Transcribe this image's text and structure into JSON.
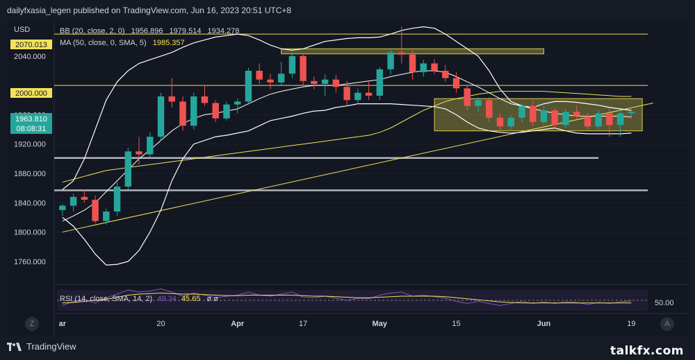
{
  "header": {
    "attribution": "dailyfxasia_legen published on TradingView.com, Jun 16, 2023 20:51 UTC+8"
  },
  "footer": {
    "brand": "TradingView",
    "watermark": "talkfx.com"
  },
  "chart_data": {
    "type": "candlestick",
    "currency": "USD",
    "indicators": {
      "bb": {
        "label": "BB (20, close, 2, 0)",
        "basis": "1956.896",
        "upper": "1979.514",
        "lower": "1934.278"
      },
      "ma": {
        "label": "MA (50, close, 0, SMA, 5)",
        "value": "1985.357"
      },
      "rsi": {
        "label": "RSI (14, close, SMA, 14, 2)",
        "value": "49.34",
        "ma_value": "45.65",
        "extra": "ø ø",
        "level": "50.00"
      }
    },
    "price_badges": {
      "last_price": "1963.810",
      "countdown": "08:08:31",
      "level_2070": "2070.013",
      "level_2000": "2000.000"
    },
    "y_axis": {
      "range": [
        1740,
        2090
      ],
      "ticks": [
        "2040.000",
        "1960.000",
        "1920.000",
        "1880.000",
        "1840.000",
        "1800.000",
        "1760.000"
      ],
      "tick_values": [
        2040,
        1960,
        1920,
        1880,
        1840,
        1800,
        1760
      ]
    },
    "x_axis": {
      "labels": [
        "ar",
        "20",
        "Apr",
        "17",
        "May",
        "15",
        "Jun",
        "19"
      ],
      "label_bar_index": [
        0,
        9,
        16,
        22,
        29,
        36,
        44,
        52
      ]
    },
    "horizontal_levels": [
      {
        "value": 2070.013,
        "color": "#f2e35a"
      },
      {
        "value": 2000.0,
        "color": "#f2e35a"
      },
      {
        "value": 1901,
        "color": "#b2b5be"
      },
      {
        "value": 1857,
        "color": "#b2b5be"
      }
    ],
    "zones": [
      {
        "from_bar": 20,
        "to_bar": 44,
        "low": 2043,
        "high": 2050
      },
      {
        "from_bar": 34,
        "to_bar": 53,
        "low": 1938,
        "high": 1982
      }
    ],
    "trendline": {
      "from": [
        0,
        1800
      ],
      "to": [
        54,
        1976
      ]
    },
    "candles": [
      {
        "o": 1830,
        "h": 1838,
        "l": 1822,
        "c": 1836
      },
      {
        "o": 1836,
        "h": 1852,
        "l": 1828,
        "c": 1848
      },
      {
        "o": 1848,
        "h": 1858,
        "l": 1840,
        "c": 1844
      },
      {
        "o": 1844,
        "h": 1850,
        "l": 1812,
        "c": 1815
      },
      {
        "o": 1815,
        "h": 1832,
        "l": 1810,
        "c": 1828
      },
      {
        "o": 1828,
        "h": 1868,
        "l": 1822,
        "c": 1862
      },
      {
        "o": 1862,
        "h": 1915,
        "l": 1858,
        "c": 1910
      },
      {
        "o": 1910,
        "h": 1930,
        "l": 1892,
        "c": 1906
      },
      {
        "o": 1906,
        "h": 1936,
        "l": 1902,
        "c": 1930
      },
      {
        "o": 1930,
        "h": 1990,
        "l": 1925,
        "c": 1985
      },
      {
        "o": 1985,
        "h": 2010,
        "l": 1970,
        "c": 1978
      },
      {
        "o": 1978,
        "h": 1985,
        "l": 1938,
        "c": 1945
      },
      {
        "o": 1945,
        "h": 1990,
        "l": 1940,
        "c": 1985
      },
      {
        "o": 1985,
        "h": 2000,
        "l": 1972,
        "c": 1976
      },
      {
        "o": 1976,
        "h": 1980,
        "l": 1950,
        "c": 1955
      },
      {
        "o": 1955,
        "h": 1978,
        "l": 1952,
        "c": 1974
      },
      {
        "o": 1974,
        "h": 1982,
        "l": 1962,
        "c": 1978
      },
      {
        "o": 1978,
        "h": 2024,
        "l": 1974,
        "c": 2020
      },
      {
        "o": 2020,
        "h": 2030,
        "l": 2002,
        "c": 2008
      },
      {
        "o": 2008,
        "h": 2016,
        "l": 1995,
        "c": 2004
      },
      {
        "o": 2004,
        "h": 2032,
        "l": 2000,
        "c": 2016
      },
      {
        "o": 2016,
        "h": 2045,
        "l": 2010,
        "c": 2040
      },
      {
        "o": 2040,
        "h": 2044,
        "l": 2000,
        "c": 2006
      },
      {
        "o": 2006,
        "h": 2012,
        "l": 1995,
        "c": 2002
      },
      {
        "o": 2002,
        "h": 2015,
        "l": 1985,
        "c": 2008
      },
      {
        "o": 2008,
        "h": 2014,
        "l": 1990,
        "c": 1998
      },
      {
        "o": 1998,
        "h": 2006,
        "l": 1972,
        "c": 1980
      },
      {
        "o": 1980,
        "h": 1996,
        "l": 1974,
        "c": 1990
      },
      {
        "o": 1990,
        "h": 2005,
        "l": 1980,
        "c": 1986
      },
      {
        "o": 1986,
        "h": 2025,
        "l": 1980,
        "c": 2022
      },
      {
        "o": 2022,
        "h": 2048,
        "l": 2015,
        "c": 2045
      },
      {
        "o": 2045,
        "h": 2080,
        "l": 2030,
        "c": 2042
      },
      {
        "o": 2042,
        "h": 2048,
        "l": 2008,
        "c": 2018
      },
      {
        "o": 2018,
        "h": 2035,
        "l": 2012,
        "c": 2030
      },
      {
        "o": 2030,
        "h": 2036,
        "l": 2015,
        "c": 2020
      },
      {
        "o": 2020,
        "h": 2028,
        "l": 2005,
        "c": 2010
      },
      {
        "o": 2010,
        "h": 2018,
        "l": 1990,
        "c": 1996
      },
      {
        "o": 1996,
        "h": 2000,
        "l": 1966,
        "c": 1972
      },
      {
        "o": 1972,
        "h": 1984,
        "l": 1964,
        "c": 1980
      },
      {
        "o": 1980,
        "h": 1984,
        "l": 1950,
        "c": 1956
      },
      {
        "o": 1956,
        "h": 1962,
        "l": 1938,
        "c": 1944
      },
      {
        "o": 1944,
        "h": 1960,
        "l": 1940,
        "c": 1956
      },
      {
        "o": 1956,
        "h": 1975,
        "l": 1950,
        "c": 1972
      },
      {
        "o": 1972,
        "h": 1980,
        "l": 1944,
        "c": 1950
      },
      {
        "o": 1950,
        "h": 1972,
        "l": 1946,
        "c": 1966
      },
      {
        "o": 1966,
        "h": 1970,
        "l": 1942,
        "c": 1946
      },
      {
        "o": 1946,
        "h": 1968,
        "l": 1942,
        "c": 1964
      },
      {
        "o": 1964,
        "h": 1972,
        "l": 1955,
        "c": 1958
      },
      {
        "o": 1958,
        "h": 1962,
        "l": 1940,
        "c": 1944
      },
      {
        "o": 1944,
        "h": 1966,
        "l": 1940,
        "c": 1962
      },
      {
        "o": 1962,
        "h": 1968,
        "l": 1930,
        "c": 1946
      },
      {
        "o": 1946,
        "h": 1966,
        "l": 1930,
        "c": 1962
      },
      {
        "o": 1962,
        "h": 1970,
        "l": 1955,
        "c": 1964
      }
    ],
    "bb_upper": [
      1858,
      1870,
      1900,
      1940,
      1980,
      2005,
      2020,
      2030,
      2035,
      2040,
      2045,
      2052,
      2058,
      2062,
      2066,
      2068,
      2070,
      2068,
      2062,
      2055,
      2050,
      2048,
      2050,
      2055,
      2060,
      2062,
      2064,
      2065,
      2065,
      2066,
      2070,
      2075,
      2078,
      2080,
      2078,
      2070,
      2060,
      2050,
      2040,
      2020,
      1995,
      1978,
      1972,
      1970,
      1975,
      1978,
      1978,
      1977,
      1975,
      1973,
      1970,
      1968,
      1966
    ],
    "bb_basis": [
      1815,
      1822,
      1830,
      1840,
      1855,
      1870,
      1885,
      1900,
      1912,
      1925,
      1938,
      1948,
      1955,
      1960,
      1962,
      1965,
      1968,
      1975,
      1982,
      1988,
      1992,
      1995,
      1998,
      2000,
      2000,
      2000,
      2002,
      2004,
      2006,
      2008,
      2012,
      2015,
      2018,
      2020,
      2020,
      2018,
      2012,
      2005,
      1998,
      1990,
      1982,
      1975,
      1972,
      1968,
      1965,
      1962,
      1960,
      1958,
      1958,
      1958,
      1958,
      1958,
      1957
    ],
    "bb_lower": [
      1820,
      1808,
      1790,
      1770,
      1755,
      1756,
      1760,
      1775,
      1800,
      1830,
      1870,
      1900,
      1920,
      1925,
      1930,
      1932,
      1935,
      1938,
      1945,
      1952,
      1955,
      1958,
      1962,
      1965,
      1966,
      1970,
      1972,
      1975,
      1975,
      1975,
      1975,
      1974,
      1973,
      1972,
      1971,
      1968,
      1960,
      1950,
      1942,
      1938,
      1936,
      1935,
      1936,
      1938,
      1940,
      1942,
      1938,
      1935,
      1934,
      1934,
      1934,
      1934,
      1935
    ],
    "ma50": [
      1868,
      1872,
      1876,
      1880,
      1884,
      1886,
      1888,
      1890,
      1892,
      1894,
      1896,
      1898,
      1900,
      1902,
      1904,
      1906,
      1908,
      1910,
      1912,
      1914,
      1916,
      1918,
      1920,
      1922,
      1924,
      1926,
      1928,
      1930,
      1932,
      1936,
      1942,
      1950,
      1958,
      1966,
      1972,
      1978,
      1982,
      1985,
      1988,
      1990,
      1992,
      1992,
      1992,
      1992,
      1992,
      1991,
      1990,
      1989,
      1988,
      1987,
      1986,
      1985,
      1985
    ],
    "rsi": [
      40,
      48,
      52,
      45,
      55,
      62,
      70,
      66,
      68,
      72,
      66,
      58,
      64,
      60,
      55,
      58,
      60,
      66,
      60,
      58,
      62,
      66,
      56,
      55,
      58,
      54,
      50,
      54,
      53,
      60,
      64,
      66,
      58,
      60,
      57,
      54,
      48,
      44,
      48,
      44,
      40,
      44,
      48,
      44,
      47,
      44,
      47,
      46,
      42,
      46,
      44,
      47,
      49
    ],
    "rsi_ma": [
      45,
      46,
      48,
      50,
      52,
      56,
      60,
      62,
      63,
      64,
      63,
      62,
      62,
      61,
      60,
      59,
      59,
      60,
      60,
      60,
      60,
      60,
      59,
      58,
      58,
      57,
      56,
      55,
      55,
      56,
      57,
      58,
      58,
      58,
      58,
      57,
      55,
      53,
      51,
      49,
      47,
      46,
      45,
      45,
      45,
      45,
      45,
      45,
      45,
      45,
      45,
      45,
      45
    ]
  }
}
